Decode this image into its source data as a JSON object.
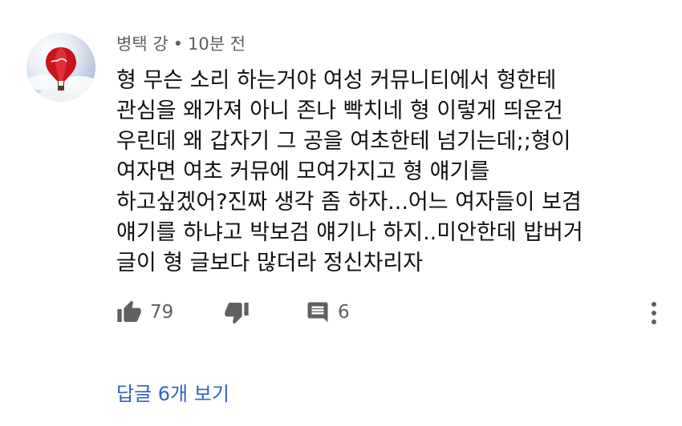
{
  "comment": {
    "author": "병택 강",
    "separator": "•",
    "time": "10분 전",
    "lines": [
      "형 무슨 소리 하는거야 여성 커뮤니티에서 형한테",
      "관심을 왜가져 아니 존나 빡치네 형 이렇게 띄운건",
      "우린데 왜 갑자기 그 공을 여초한테 넘기는데;;형이",
      "여자면 여초 커뮤에 모여가지고 형 얘기를",
      "하고싶겠어?진짜 생각 좀 하자...어느 여자들이 보겸",
      "얘기를 하냐고 박보검 얘기나 하지..미안한데 밥버거",
      "글이 형 글보다 많더라 정신차리자"
    ],
    "like_count": "79",
    "reply_count": "6",
    "view_replies": "답글 6개 보기"
  },
  "icons": {
    "like": "thumbs-up-icon",
    "dislike": "thumbs-down-icon",
    "reply": "comment-icon",
    "more": "more-vertical-icon"
  },
  "colors": {
    "meta_text": "#606060",
    "link": "#3160c4",
    "icon": "#606060"
  }
}
